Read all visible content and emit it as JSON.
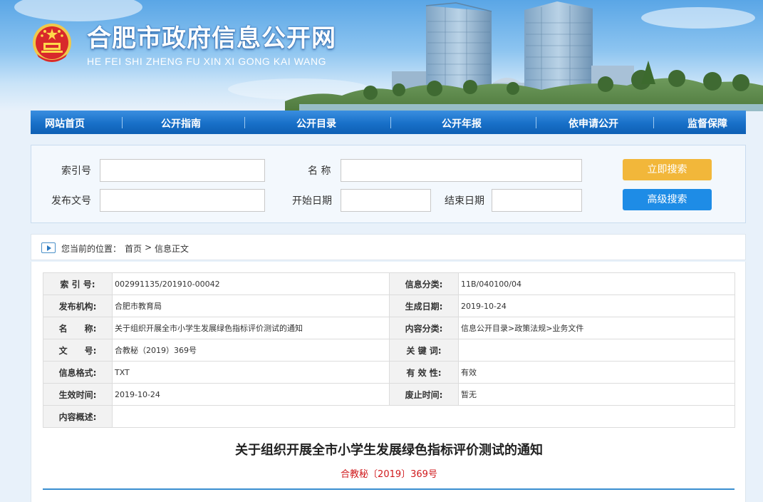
{
  "header": {
    "title": "合肥市政府信息公开网",
    "subtitle": "HE FEI SHI ZHENG FU XIN XI GONG KAI WANG"
  },
  "nav": {
    "items": [
      {
        "label": "网站首页"
      },
      {
        "label": "公开指南"
      },
      {
        "label": "公开目录"
      },
      {
        "label": "公开年报"
      },
      {
        "label": "依申请公开"
      },
      {
        "label": "监督保障"
      }
    ]
  },
  "search": {
    "index_label": "索引号",
    "name_label": "名 称",
    "docno_label": "发布文号",
    "start_label": "开始日期",
    "end_label": "结束日期",
    "search_button": "立即搜索",
    "advanced_button": "高级搜索",
    "index_value": "",
    "name_value": "",
    "docno_value": "",
    "start_value": "",
    "end_value": ""
  },
  "breadcrumb": {
    "prefix": "您当前的位置：",
    "home": "首页",
    "separator": ">",
    "current": "信息正文"
  },
  "info": {
    "rows": [
      {
        "l1": "索 引 号:",
        "v1": "002991135/201910-00042",
        "l2": "信息分类:",
        "v2": "11B/040100/04"
      },
      {
        "l1": "发布机构:",
        "v1": "合肥市教育局",
        "l2": "生成日期:",
        "v2": "2019-10-24"
      },
      {
        "l1": "名　　称:",
        "v1": "关于组织开展全市小学生发展绿色指标评价测试的通知",
        "l2": "内容分类:",
        "v2": "信息公开目录>政策法规>业务文件"
      },
      {
        "l1": "文　　号:",
        "v1": "合教秘（2019）369号",
        "l2": "关 键 词:",
        "v2": ""
      },
      {
        "l1": "信息格式:",
        "v1": "TXT",
        "l2": "有 效 性:",
        "v2": "有效"
      },
      {
        "l1": "生效时间:",
        "v1": "2019-10-24",
        "l2": "废止时间:",
        "v2": "暂无"
      }
    ],
    "summary_label": "内容概述:",
    "summary_value": ""
  },
  "document": {
    "title": "关于组织开展全市小学生发展绿色指标评价测试的通知",
    "number": "合教秘〔2019〕369号"
  },
  "colors": {
    "nav_blue": "#1870c8",
    "search_yellow": "#f2b73a",
    "search_blue": "#1e8ce6",
    "doc_number_red": "#d0191c"
  }
}
